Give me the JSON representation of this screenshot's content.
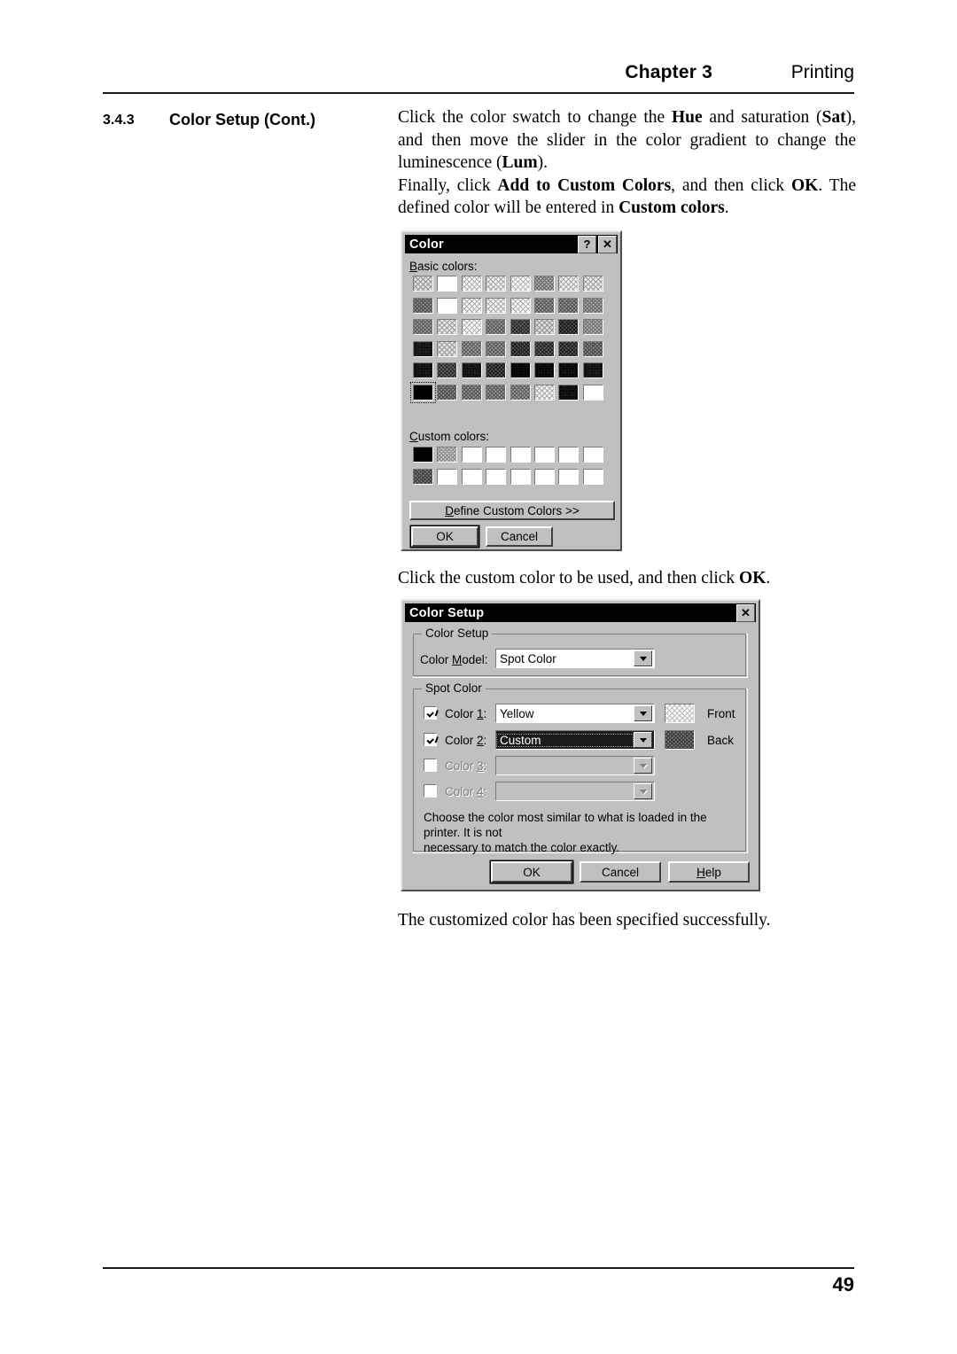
{
  "page": {
    "header": {
      "chapter": "Chapter 3",
      "section": "Printing"
    },
    "footer": {
      "page_number": "49"
    },
    "section": {
      "number": "3.4.3",
      "title": "Color Setup (Cont.)"
    },
    "paragraphs": [
      "Click the color swatch to change the <b>Hue</b> and saturation (<b>Sat</b>), and then move the slider in the color gradient to change the luminescence (<b>Lum</b>).",
      "Finally, click <b>Add to Custom Colors</b>, and then click <b>OK</b>.  The defined color will be entered in <b>Custom colors</b>."
    ],
    "caption_mid": "Click the custom color to be used, and then click <b>OK</b>.",
    "caption_bottom": "The customized color has been specified successfully."
  },
  "color_dialog": {
    "title": "Color",
    "titlebar_buttons": [
      {
        "name": "help-button",
        "glyph": "?"
      },
      {
        "name": "close-button",
        "glyph": "✕"
      }
    ],
    "basic_colors_label": "Basic colors:",
    "custom_colors_label": "Custom colors:",
    "basic_colors": [
      [
        "#c9c9c9",
        "#fcfcfc",
        "#e2e2e2",
        "#d9d9d9",
        "#e8e8e8",
        "#9e9e9e",
        "#dadada",
        "#d2d2d2"
      ],
      [
        "#808080",
        "#f7f7f7",
        "#e0e0e0",
        "#dcdcdc",
        "#e4e4e4",
        "#888888",
        "#858585",
        "#999999"
      ],
      [
        "#8c8c8c",
        "#cfcfcf",
        "#e6e6e6",
        "#8a8a8a",
        "#5a5a5a",
        "#c6c6c6",
        "#4a4a4a",
        "#a2a2a2"
      ],
      [
        "#3e3e3e",
        "#cccccc",
        "#8e8e8e",
        "#8a8a8a",
        "#4d4d4d",
        "#555555",
        "#4f4f4f",
        "#7b7b7b"
      ],
      [
        "#3a3a3a",
        "#5c5c5c",
        "#3d3d3d",
        "#4c4c4c",
        "#1e1e1e",
        "#2b2b2b",
        "#333333",
        "#3c3c3c"
      ],
      [
        "#000000",
        "#7d7d7d",
        "#858585",
        "#898989",
        "#8d8d8d",
        "#dcdcdc",
        "#373737",
        "#ffffff"
      ]
    ],
    "basic_selected_index": [
      5,
      0
    ],
    "custom_colors": [
      [
        "#000000",
        "#b9b9b9",
        "#ffffff",
        "#ffffff",
        "#ffffff",
        "#ffffff",
        "#ffffff",
        "#ffffff"
      ],
      [
        "#6e6e6e",
        "#ffffff",
        "#ffffff",
        "#ffffff",
        "#ffffff",
        "#ffffff",
        "#ffffff",
        "#ffffff"
      ]
    ],
    "buttons": {
      "define": "Define Custom Colors >>",
      "define_accel": "D",
      "ok": "OK",
      "cancel": "Cancel"
    }
  },
  "color_setup_dialog": {
    "title": "Color Setup",
    "close_glyph": "✕",
    "group_color_setup": {
      "legend": "Color Setup",
      "color_model_label_pre": "Color ",
      "color_model_label_accel": "M",
      "color_model_label_post": "odel:",
      "color_model_value": "Spot Color"
    },
    "group_spot_color": {
      "legend": "Spot Color",
      "rows": [
        {
          "label_pre": "Color ",
          "label_accel": "1",
          "label_post": ":",
          "checked": true,
          "enabled": true,
          "value": "Yellow",
          "selected": false,
          "swatch": "#f0f0f0",
          "side": "Front"
        },
        {
          "label_pre": "Color ",
          "label_accel": "2",
          "label_post": ":",
          "checked": true,
          "enabled": true,
          "value": "Custom",
          "selected": true,
          "swatch": "#6b6b6b",
          "side": "Back"
        },
        {
          "label_pre": "Color ",
          "label_accel": "3",
          "label_post": ":",
          "checked": false,
          "enabled": false,
          "value": "",
          "selected": false,
          "swatch": "",
          "side": ""
        },
        {
          "label_pre": "Color ",
          "label_accel": "4",
          "label_post": ":",
          "checked": false,
          "enabled": false,
          "value": "",
          "selected": false,
          "swatch": "",
          "side": ""
        }
      ],
      "info_line1": "Choose the color most similar to what is loaded in the printer.  It is not",
      "info_line2": "necessary to match the color exactly."
    },
    "buttons": {
      "ok": "OK",
      "cancel": "Cancel",
      "help_pre": "",
      "help_accel": "H",
      "help_post": "elp"
    }
  }
}
